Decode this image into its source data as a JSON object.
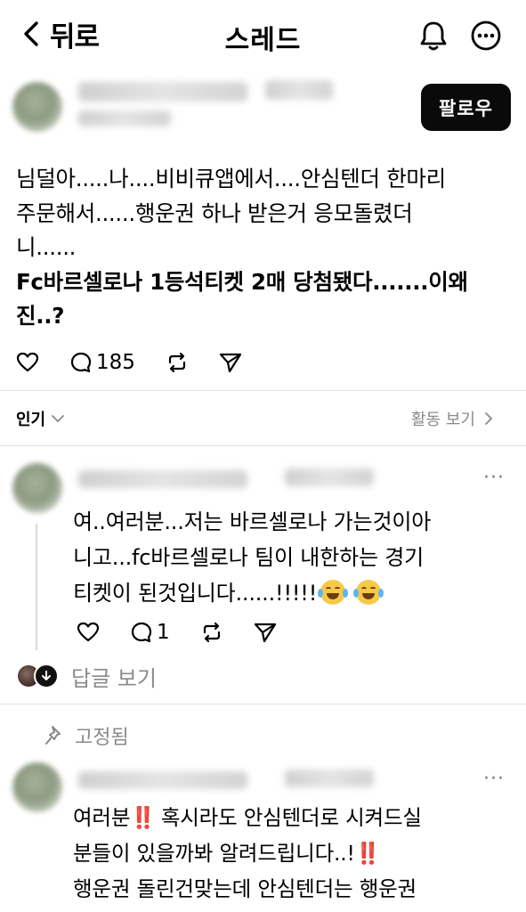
{
  "header": {
    "back_label": "뒤로",
    "title": "스레드"
  },
  "post": {
    "follow_label": "팔로우",
    "lines": [
      "님덜아.....나....비비큐앱에서....안심텐더 한마리",
      "주문해서......행운권 하나 받은거 응모돌렸더",
      "니......",
      "Fc바르셀로나 1등석티켓 2매 당첨됐다.......이왜",
      "진..?"
    ],
    "reply_count": "185"
  },
  "sort": {
    "label": "인기",
    "activity_label": "활동 보기"
  },
  "comments": [
    {
      "lines": [
        "여..여러분...저는 바르셀로나 가는것이아",
        "니고...fc바르셀로나 팀이 내한하는 경기",
        "티켓이 된것입니다......!!!!!"
      ],
      "reply_count": "1",
      "view_replies_label": "답글 보기"
    },
    {
      "pinned_label": "고정됨",
      "lines": [
        "여러분",
        "‼️",
        "혹시라도 안심텐더로 시켜드실",
        "분들이 있을까봐 알려드립니다..!",
        "‼️",
        "행운권 돌린건맞는데 안심텐더는 행운권"
      ]
    }
  ],
  "icons": {
    "back": "chevron-left-icon",
    "notifications": "bell-icon",
    "more": "more-circle-icon",
    "like": "heart-icon",
    "reply": "comment-icon",
    "repost": "repost-icon",
    "share": "send-icon",
    "emoji": "face-tears-of-joy-icon",
    "pin": "pin-icon"
  }
}
